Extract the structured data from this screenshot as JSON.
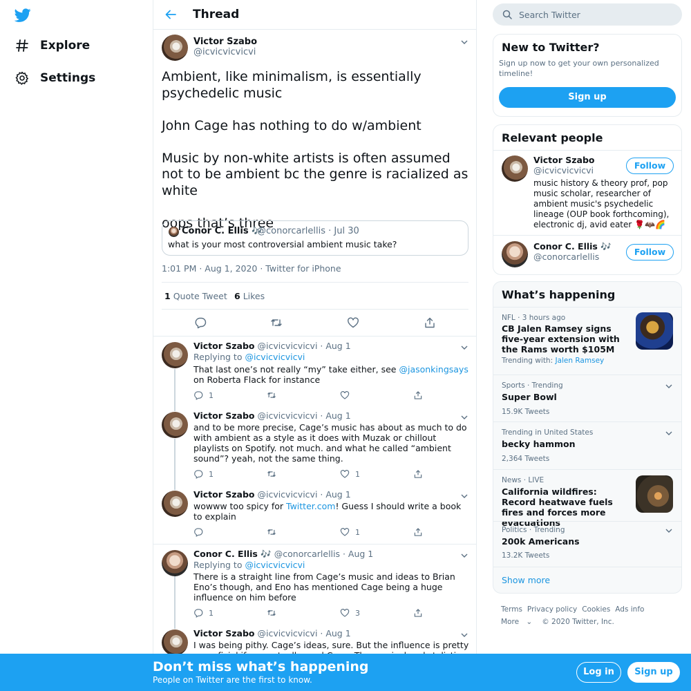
{
  "nav": {
    "logo": "twitter-bird-icon",
    "items": [
      {
        "label": "Explore",
        "icon": "hash-icon"
      },
      {
        "label": "Settings",
        "icon": "gear-icon"
      }
    ]
  },
  "header": {
    "title": "Thread",
    "back_icon": "arrow-left-icon"
  },
  "main_tweet": {
    "name": "Victor Szabo",
    "handle": "@icvicvicvicvi",
    "paragraphs": [
      "Ambient, like minimalism, is essentially psychedelic music",
      "John Cage has nothing to do w/ambient",
      "Music by non-white artists is often assumed not to be ambient bc the genre is racialized as white",
      "oops that’s three"
    ],
    "quote": {
      "name": "Conor C. Ellis 🎶",
      "meta": "@conorcarlellis · Jul 30",
      "text": "what is your most controversial ambient music take?"
    },
    "meta": "1:01 PM · Aug 1, 2020 · Twitter for iPhone",
    "quote_count": "1",
    "quote_label": "Quote Tweet",
    "like_count": "6",
    "like_label": "Likes"
  },
  "replies": [
    {
      "name": "Victor Szabo",
      "meta": "@icvicvicvicvi · Aug 1",
      "replying_prefix": "Replying to ",
      "replying_to": "@icvicvicvicvi",
      "text_a": "That last one’s not really “my” take either, see ",
      "text_link": "@jasonkingsays",
      "text_b": " on Roberta Flack for instance",
      "reply_count": "1",
      "like_count": ""
    },
    {
      "name": "Victor Szabo",
      "meta": "@icvicvicvicvi · Aug 1",
      "text": "and to be more precise, Cage’s music has about as much to do with ambient as a style as it does with Muzak or chillout playlists on Spotify. not much. and what he called “ambient sound”? yeah, not the same thing.",
      "reply_count": "1",
      "like_count": "1"
    },
    {
      "name": "Victor Szabo",
      "meta": "@icvicvicvicvi · Aug 1",
      "text_a": "wowww too spicy for ",
      "text_link": "Twitter.com",
      "text_b": "! Guess I should write a book to explain",
      "reply_count": "",
      "like_count": "1"
    },
    {
      "name": "Conor C. Ellis 🎶",
      "meta": "@conorcarlellis · Aug 1",
      "replying_prefix": "Replying to ",
      "replying_to": "@icvicvicvicvi",
      "text": "There is a straight line from Cage’s music and ideas to Brian Eno’s though, and Eno has mentioned Cage being a huge influence on him before",
      "reply_count": "1",
      "like_count": "3"
    },
    {
      "name": "Victor Szabo",
      "meta": "@icvicvicvicvi · Aug 1",
      "text": "I was being pithy. Cage’s ideas, sure. But the influence is pretty superficial if you actually read Cage. The musical and stylistic"
    }
  ],
  "search": {
    "placeholder": "Search Twitter",
    "icon": "search-icon"
  },
  "signup_panel": {
    "title": "New to Twitter?",
    "text": "Sign up now to get your own personalized timeline!",
    "button": "Sign up"
  },
  "relevant": {
    "title": "Relevant people",
    "people": [
      {
        "name": "Victor Szabo",
        "handle": "@icvicvicvicvi",
        "bio": "music history & theory prof, pop music scholar, researcher of ambient music's psychedelic lineage (OUP book forthcoming), electronic dj, avid eater 🌹🦇🌈",
        "button": "Follow"
      },
      {
        "name": "Conor C. Ellis 🎶",
        "handle": "@conorcarlellis",
        "button": "Follow"
      }
    ]
  },
  "happening": {
    "title": "What’s happening",
    "trends": [
      {
        "meta": "NFL · 3 hours ago",
        "title": "CB Jalen Ramsey signs five-year extension with the Rams worth $105M",
        "trending_prefix": "Trending with: ",
        "trending_with": "Jalen Ramsey"
      },
      {
        "meta": "Sports · Trending",
        "title": "Super Bowl",
        "sub": "15.9K Tweets"
      },
      {
        "meta": "Trending in United States",
        "title": "becky hammon",
        "sub": "2,364 Tweets"
      },
      {
        "meta_a": "News · ",
        "meta_b": "LIVE",
        "title": "California wildfires: Record heatwave fuels fires and forces more evacuations"
      },
      {
        "meta": "Politics · Trending",
        "title": "200k Americans",
        "sub": "13.2K Tweets"
      }
    ],
    "show_more": "Show more"
  },
  "footer": {
    "links": [
      "Terms",
      "Privacy policy",
      "Cookies",
      "Ads info"
    ],
    "more": "More",
    "copyright": "© 2020 Twitter, Inc."
  },
  "bottom_bar": {
    "title": "Don’t miss what’s happening",
    "subtitle": "People on Twitter are the first to know.",
    "login": "Log in",
    "signup": "Sign up"
  },
  "colors": {
    "accent": "#1da1f2",
    "link": "#1b95e0",
    "muted": "#5b7083",
    "border": "#e6ecf0",
    "background": "#ffffff"
  }
}
